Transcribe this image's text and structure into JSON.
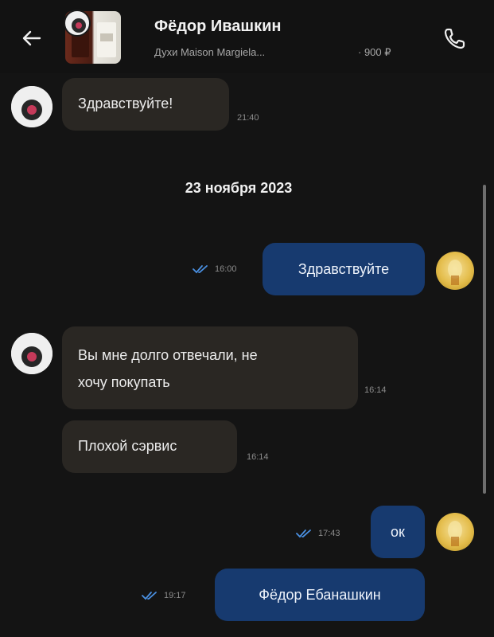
{
  "header": {
    "contact_name": "Фёдор Ивашкин",
    "listing_title": "Духи Maison Margiela...",
    "listing_price": "· 900 ₽",
    "back_icon": "arrow-left-icon",
    "call_icon": "phone-icon"
  },
  "date_divider": "23 ноября 2023",
  "messages": [
    {
      "direction": "in",
      "text": "Здравствуйте!",
      "time": "21:40"
    },
    {
      "direction": "out",
      "text": "Здравствуйте",
      "time": "16:00",
      "status": "read"
    },
    {
      "direction": "in",
      "text": "Вы мне долго отвечали, не хочу покупать",
      "line1": "Вы мне долго отвечали, не",
      "line2": "хочу покупать",
      "time": "16:14"
    },
    {
      "direction": "in",
      "text": "Плохой сэрвис",
      "time": "16:14"
    },
    {
      "direction": "out",
      "text": "ок",
      "time": "17:43",
      "status": "read"
    },
    {
      "direction": "out",
      "text": "Фёдор Ебанашкин",
      "time": "19:17",
      "status": "read"
    }
  ],
  "colors": {
    "background": "#141414",
    "incoming_bubble": "#2a2723",
    "outgoing_bubble": "#173a6f",
    "read_check": "#4a90e2"
  }
}
